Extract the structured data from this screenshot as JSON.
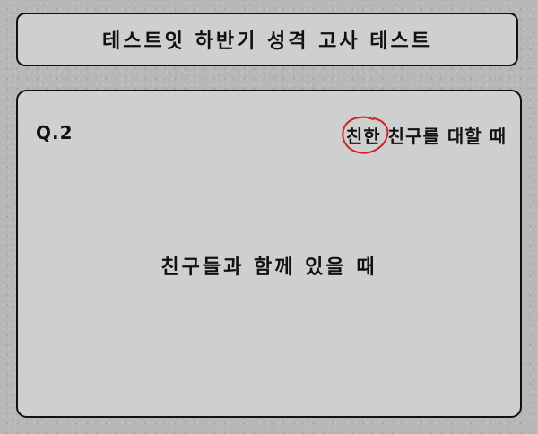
{
  "header": {
    "title": "테스트잇 하반기 성격 고사 테스트"
  },
  "question": {
    "number": "Q.2",
    "heading_circled": "친한",
    "heading_rest": " 친구를 대할 때",
    "text": "친구들과 함께 있을 때"
  },
  "annotation": {
    "circle_color": "#d42020"
  }
}
